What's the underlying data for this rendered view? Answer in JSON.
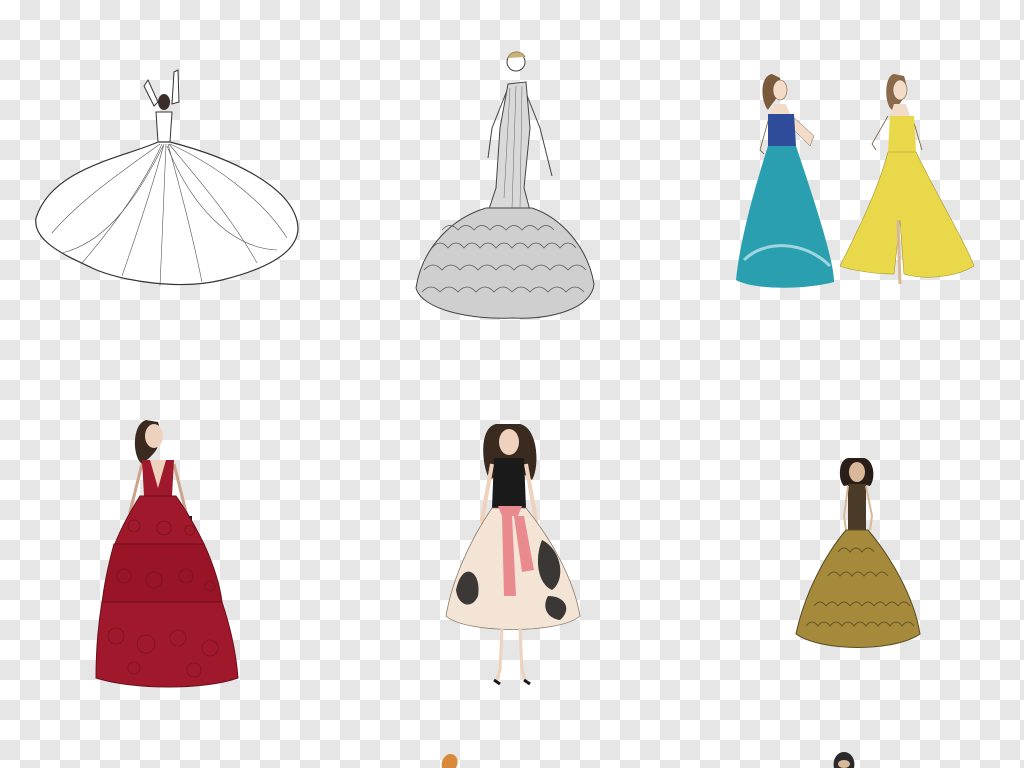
{
  "canvas": {
    "background": "transparency-checkerboard",
    "checker_light": "#ffffff",
    "checker_dark": "#e6e6e6"
  },
  "figures": [
    {
      "id": "fig1",
      "subject": "white-pleated-ballgown-sketch",
      "palette": [
        "#ffffff",
        "#333333"
      ]
    },
    {
      "id": "fig2",
      "subject": "grey-ruffled-mermaid-gown-sketch",
      "palette": [
        "#d9d9d9",
        "#555555"
      ]
    },
    {
      "id": "fig3",
      "subject": "two-strapless-gowns-teal-and-yellow",
      "palette": [
        "#2a9fb0",
        "#e8d84a"
      ]
    },
    {
      "id": "fig4",
      "subject": "red-tiered-lace-gown",
      "palette": [
        "#a0182c",
        "#6b0f1d"
      ]
    },
    {
      "id": "fig5",
      "subject": "black-top-floral-skirt-pink-sash-gown",
      "palette": [
        "#1a1a1a",
        "#f3e4d6",
        "#e88a8e"
      ]
    },
    {
      "id": "fig6",
      "subject": "gold-textured-ballgown",
      "palette": [
        "#a48a3a",
        "#5a4a28"
      ]
    },
    {
      "id": "fig7",
      "subject": "partial-figure-hair-orange",
      "palette": [
        "#d88a3a"
      ]
    },
    {
      "id": "fig8",
      "subject": "partial-figure-hair-dark",
      "palette": [
        "#2a2a2a"
      ]
    }
  ]
}
